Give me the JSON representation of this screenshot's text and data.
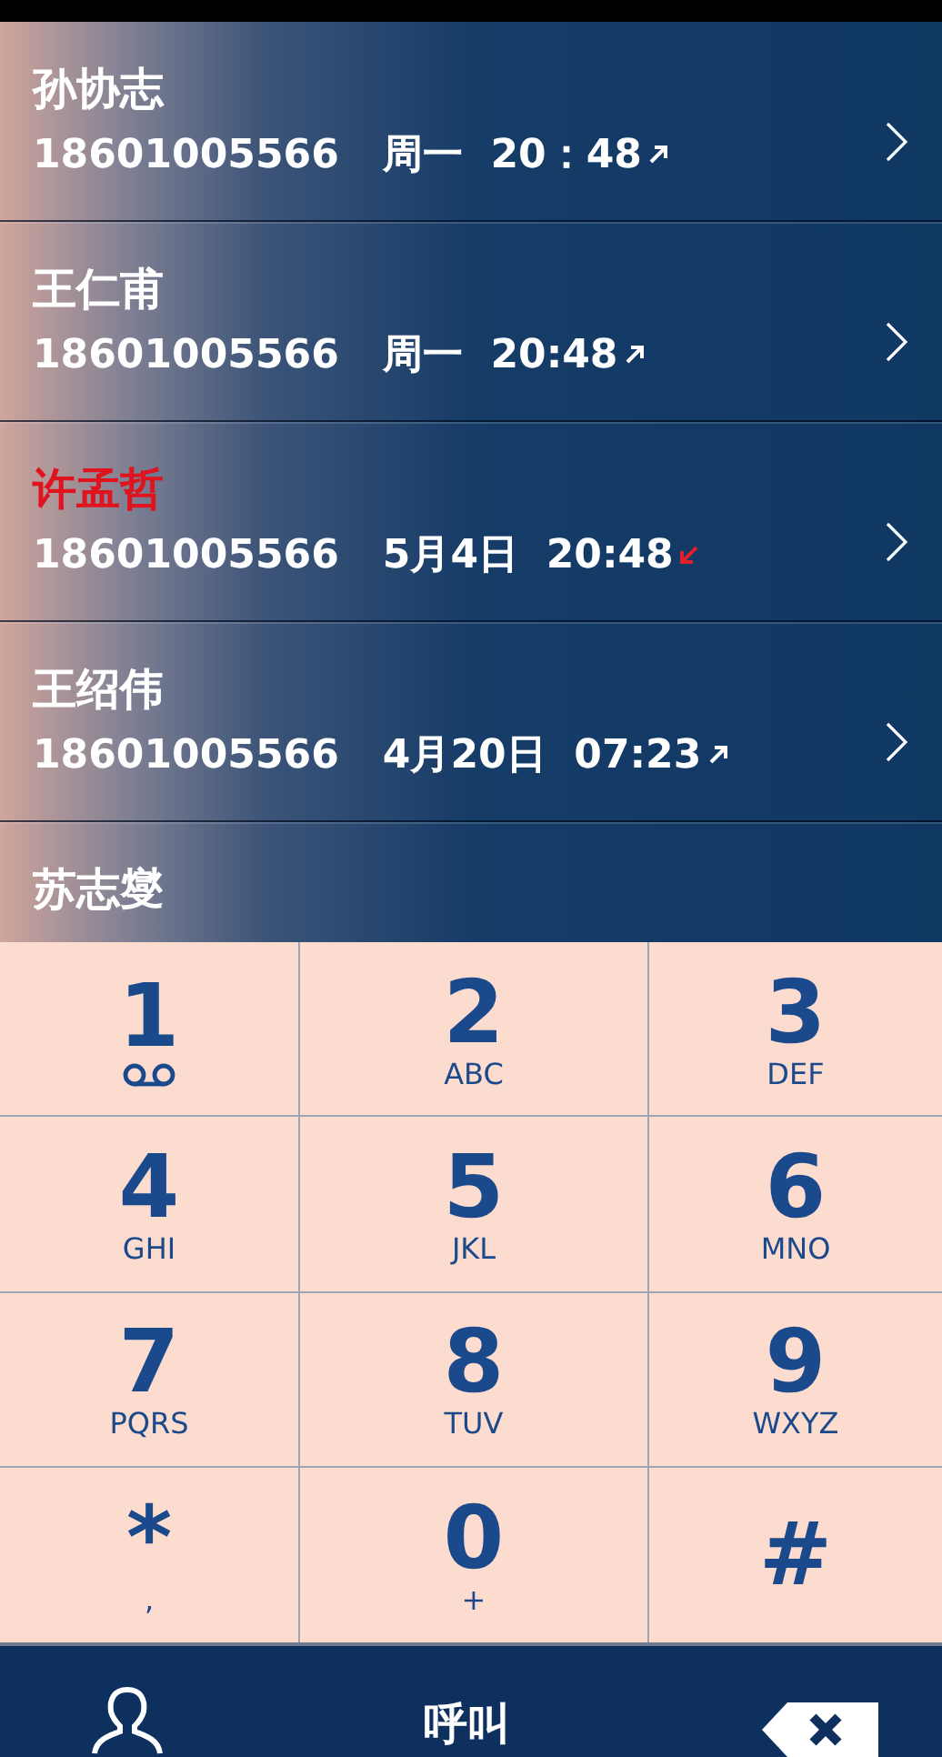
{
  "calls": [
    {
      "name": "孙协志",
      "number": "18601005566",
      "when": "周一  20：48",
      "kind": "outgoing"
    },
    {
      "name": "王仁甫",
      "number": "18601005566",
      "when": "周一  20:48",
      "kind": "outgoing"
    },
    {
      "name": "许孟哲",
      "number": "18601005566",
      "when": "5月4日  20:48",
      "kind": "missed"
    },
    {
      "name": "王绍伟",
      "number": "18601005566",
      "when": "4月20日  07:23",
      "kind": "outgoing"
    },
    {
      "name": "苏志燮",
      "kind": "partial"
    }
  ],
  "keypad": [
    {
      "digit": "1",
      "kind": "voicemail"
    },
    {
      "digit": "2",
      "sub": "ABC",
      "kind": "text"
    },
    {
      "digit": "3",
      "sub": "DEF",
      "kind": "text"
    },
    {
      "digit": "4",
      "sub": "GHI",
      "kind": "text"
    },
    {
      "digit": "5",
      "sub": "JKL",
      "kind": "text"
    },
    {
      "digit": "6",
      "sub": "MNO",
      "kind": "text"
    },
    {
      "digit": "7",
      "sub": "PQRS",
      "kind": "text"
    },
    {
      "digit": "8",
      "sub": "TUV",
      "kind": "text"
    },
    {
      "digit": "9",
      "sub": "WXYZ",
      "kind": "text"
    },
    {
      "digit": "*",
      "sub": ",",
      "kind": "text"
    },
    {
      "digit": "0",
      "sub": "+",
      "kind": "text"
    },
    {
      "digit": "#",
      "kind": "text"
    }
  ],
  "bottom_bar": {
    "call_label": "呼叫"
  }
}
